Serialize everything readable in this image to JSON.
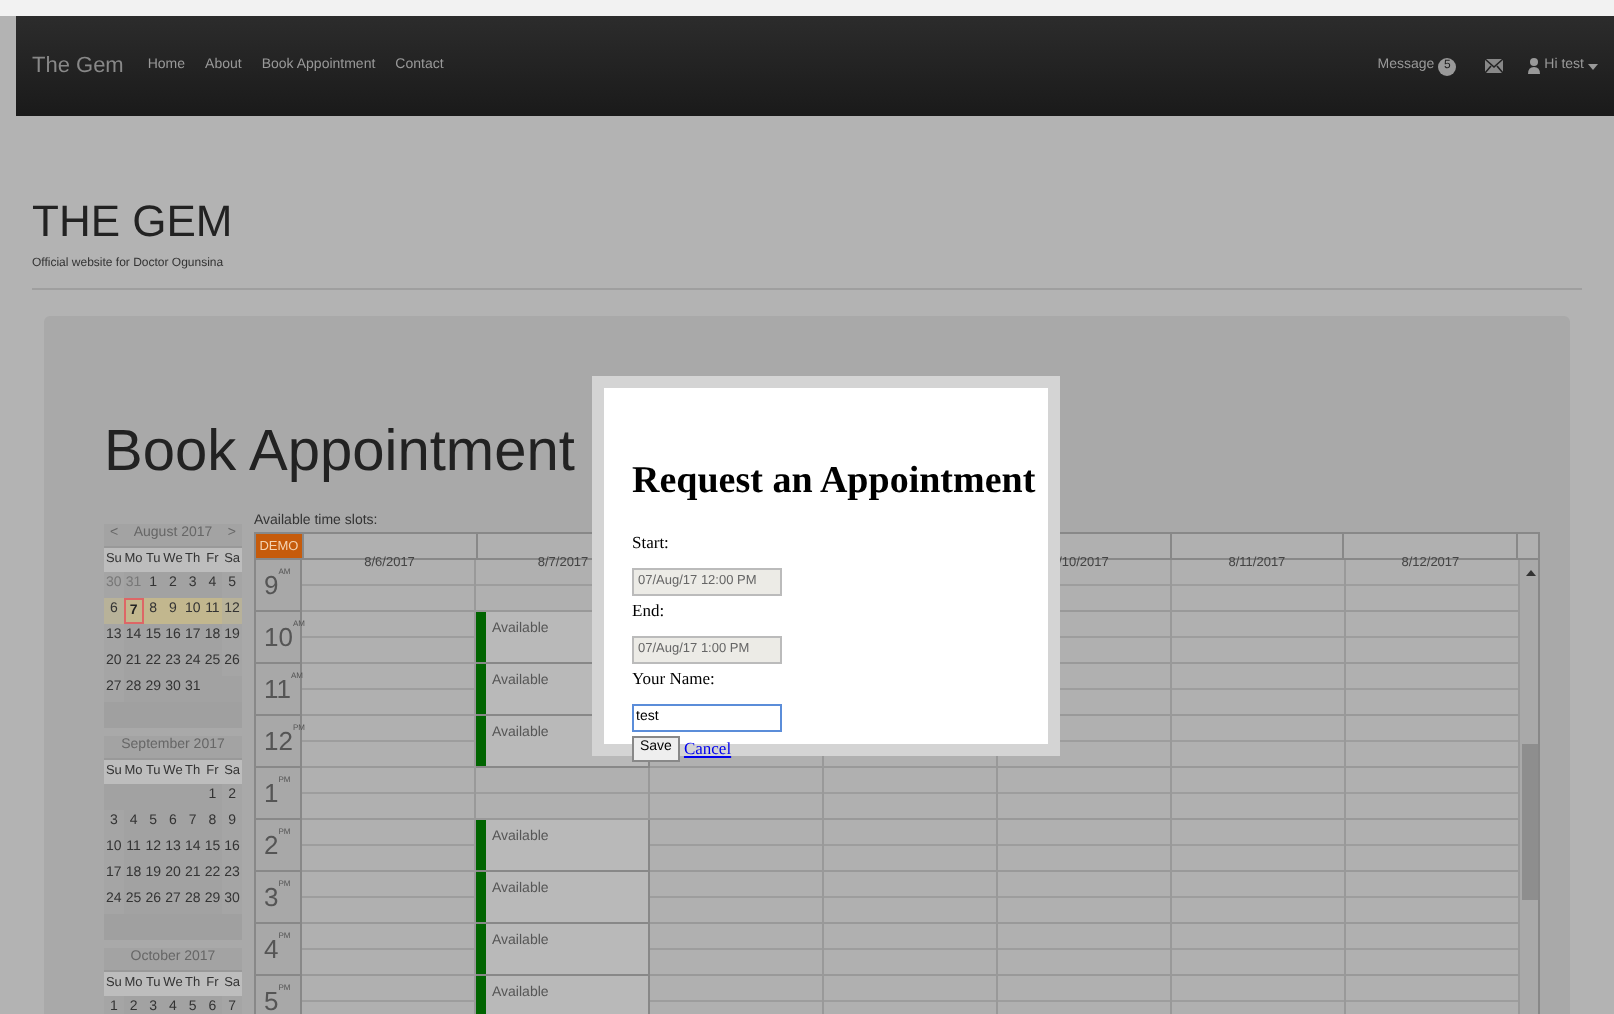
{
  "navbar": {
    "brand": "The Gem",
    "links": [
      "Home",
      "About",
      "Book Appointment",
      "Contact"
    ],
    "message": {
      "label": "Message",
      "count": "5"
    },
    "user": "Hi test"
  },
  "header": {
    "title": "THE GEM",
    "subtitle": "Official website for Doctor Ogunsina"
  },
  "page_title": "Book Appointment",
  "months": [
    {
      "title": "August 2017",
      "prev": "<",
      "next": ">",
      "weekdays": [
        "Su",
        "Mo",
        "Tu",
        "We",
        "Th",
        "Fr",
        "Sa"
      ],
      "weeks": [
        {
          "selected": false,
          "days": [
            {
              "t": "30",
              "kind": "other"
            },
            {
              "t": "31",
              "kind": "other"
            },
            {
              "t": "1",
              "kind": "day"
            },
            {
              "t": "2",
              "kind": "day"
            },
            {
              "t": "3",
              "kind": "day"
            },
            {
              "t": "4",
              "kind": "day"
            },
            {
              "t": "5",
              "kind": "day"
            }
          ]
        },
        {
          "selected": true,
          "days": [
            {
              "t": "6",
              "kind": "day"
            },
            {
              "t": "7",
              "kind": "today"
            },
            {
              "t": "8",
              "kind": "day"
            },
            {
              "t": "9",
              "kind": "day"
            },
            {
              "t": "10",
              "kind": "day"
            },
            {
              "t": "11",
              "kind": "day"
            },
            {
              "t": "12",
              "kind": "day"
            }
          ]
        },
        {
          "selected": false,
          "days": [
            {
              "t": "13",
              "kind": "day"
            },
            {
              "t": "14",
              "kind": "day"
            },
            {
              "t": "15",
              "kind": "day"
            },
            {
              "t": "16",
              "kind": "day"
            },
            {
              "t": "17",
              "kind": "day"
            },
            {
              "t": "18",
              "kind": "day"
            },
            {
              "t": "19",
              "kind": "day"
            }
          ]
        },
        {
          "selected": false,
          "days": [
            {
              "t": "20",
              "kind": "day"
            },
            {
              "t": "21",
              "kind": "day"
            },
            {
              "t": "22",
              "kind": "day"
            },
            {
              "t": "23",
              "kind": "day"
            },
            {
              "t": "24",
              "kind": "day"
            },
            {
              "t": "25",
              "kind": "day"
            },
            {
              "t": "26",
              "kind": "day"
            }
          ]
        },
        {
          "selected": false,
          "days": [
            {
              "t": "27",
              "kind": "day"
            },
            {
              "t": "28",
              "kind": "day"
            },
            {
              "t": "29",
              "kind": "day"
            },
            {
              "t": "30",
              "kind": "day"
            },
            {
              "t": "31",
              "kind": "day"
            },
            {
              "kind": "blank"
            },
            {
              "kind": "blank"
            }
          ]
        }
      ]
    },
    {
      "title": "September 2017",
      "weekdays": [
        "Su",
        "Mo",
        "Tu",
        "We",
        "Th",
        "Fr",
        "Sa"
      ],
      "weeks": [
        {
          "selected": false,
          "days": [
            {
              "kind": "blank"
            },
            {
              "kind": "blank"
            },
            {
              "kind": "blank"
            },
            {
              "kind": "blank"
            },
            {
              "kind": "blank"
            },
            {
              "t": "1",
              "kind": "day"
            },
            {
              "t": "2",
              "kind": "day"
            }
          ]
        },
        {
          "selected": false,
          "days": [
            {
              "t": "3",
              "kind": "day"
            },
            {
              "t": "4",
              "kind": "day"
            },
            {
              "t": "5",
              "kind": "day"
            },
            {
              "t": "6",
              "kind": "day"
            },
            {
              "t": "7",
              "kind": "day"
            },
            {
              "t": "8",
              "kind": "day"
            },
            {
              "t": "9",
              "kind": "day"
            }
          ]
        },
        {
          "selected": false,
          "days": [
            {
              "t": "10",
              "kind": "day"
            },
            {
              "t": "11",
              "kind": "day"
            },
            {
              "t": "12",
              "kind": "day"
            },
            {
              "t": "13",
              "kind": "day"
            },
            {
              "t": "14",
              "kind": "day"
            },
            {
              "t": "15",
              "kind": "day"
            },
            {
              "t": "16",
              "kind": "day"
            }
          ]
        },
        {
          "selected": false,
          "days": [
            {
              "t": "17",
              "kind": "day"
            },
            {
              "t": "18",
              "kind": "day"
            },
            {
              "t": "19",
              "kind": "day"
            },
            {
              "t": "20",
              "kind": "day"
            },
            {
              "t": "21",
              "kind": "day"
            },
            {
              "t": "22",
              "kind": "day"
            },
            {
              "t": "23",
              "kind": "day"
            }
          ]
        },
        {
          "selected": false,
          "days": [
            {
              "t": "24",
              "kind": "day"
            },
            {
              "t": "25",
              "kind": "day"
            },
            {
              "t": "26",
              "kind": "day"
            },
            {
              "t": "27",
              "kind": "day"
            },
            {
              "t": "28",
              "kind": "day"
            },
            {
              "t": "29",
              "kind": "day"
            },
            {
              "t": "30",
              "kind": "day"
            }
          ]
        }
      ]
    },
    {
      "title": "October 2017",
      "weekdays": [
        "Su",
        "Mo",
        "Tu",
        "We",
        "Th",
        "Fr",
        "Sa"
      ],
      "weeks": [
        {
          "selected": false,
          "days": [
            {
              "t": "1",
              "kind": "day"
            },
            {
              "t": "2",
              "kind": "day"
            },
            {
              "t": "3",
              "kind": "day"
            },
            {
              "t": "4",
              "kind": "day"
            },
            {
              "t": "5",
              "kind": "day"
            },
            {
              "t": "6",
              "kind": "day"
            },
            {
              "t": "7",
              "kind": "day"
            }
          ]
        }
      ]
    }
  ],
  "schedule": {
    "caption": "Available time slots:",
    "badge": "DEMO",
    "columns": [
      {
        "label": "8/6/2017"
      },
      {
        "label": "8/7/2017"
      },
      {},
      {},
      {
        "label": "/10/2017"
      },
      {
        "label": "8/11/2017"
      },
      {
        "label": "8/12/2017"
      }
    ],
    "hours": [
      {
        "hour": "9",
        "period": "AM",
        "slots": [
          {
            "kind": "free"
          },
          {
            "kind": "free"
          },
          {
            "kind": "free"
          },
          {
            "kind": "free"
          },
          {
            "kind": "free"
          },
          {
            "kind": "free"
          },
          {
            "kind": "free"
          }
        ]
      },
      {
        "hour": "10",
        "period": "AM",
        "slots": [
          {
            "kind": "free"
          },
          {
            "kind": "event",
            "label": "Available"
          },
          {
            "kind": "free"
          },
          {
            "kind": "free"
          },
          {
            "kind": "free"
          },
          {
            "kind": "free"
          },
          {
            "kind": "free"
          }
        ]
      },
      {
        "hour": "11",
        "period": "AM",
        "slots": [
          {
            "kind": "free"
          },
          {
            "kind": "event",
            "label": "Available"
          },
          {
            "kind": "free"
          },
          {
            "kind": "free"
          },
          {
            "kind": "free"
          },
          {
            "kind": "free"
          },
          {
            "kind": "free"
          }
        ]
      },
      {
        "hour": "12",
        "period": "PM",
        "slots": [
          {
            "kind": "free"
          },
          {
            "kind": "event",
            "label": "Available"
          },
          {
            "kind": "free"
          },
          {
            "kind": "free"
          },
          {
            "kind": "free"
          },
          {
            "kind": "free"
          },
          {
            "kind": "free"
          }
        ]
      },
      {
        "hour": "1",
        "period": "PM",
        "slots": [
          {
            "kind": "free"
          },
          {
            "kind": "free"
          },
          {
            "kind": "free"
          },
          {
            "kind": "free"
          },
          {
            "kind": "free"
          },
          {
            "kind": "free"
          },
          {
            "kind": "free"
          }
        ]
      },
      {
        "hour": "2",
        "period": "PM",
        "slots": [
          {
            "kind": "free"
          },
          {
            "kind": "event",
            "label": "Available"
          },
          {
            "kind": "free"
          },
          {
            "kind": "free"
          },
          {
            "kind": "free"
          },
          {
            "kind": "free"
          },
          {
            "kind": "free"
          }
        ]
      },
      {
        "hour": "3",
        "period": "PM",
        "slots": [
          {
            "kind": "free"
          },
          {
            "kind": "event",
            "label": "Available"
          },
          {
            "kind": "free"
          },
          {
            "kind": "free"
          },
          {
            "kind": "free"
          },
          {
            "kind": "free"
          },
          {
            "kind": "free"
          }
        ]
      },
      {
        "hour": "4",
        "period": "PM",
        "slots": [
          {
            "kind": "free"
          },
          {
            "kind": "event",
            "label": "Available"
          },
          {
            "kind": "free"
          },
          {
            "kind": "free"
          },
          {
            "kind": "free"
          },
          {
            "kind": "free"
          },
          {
            "kind": "free"
          }
        ]
      },
      {
        "hour": "5",
        "period": "PM",
        "slots": [
          {
            "kind": "free"
          },
          {
            "kind": "event",
            "label": "Available"
          },
          {
            "kind": "free"
          },
          {
            "kind": "free"
          },
          {
            "kind": "free"
          },
          {
            "kind": "free"
          },
          {
            "kind": "free"
          }
        ]
      }
    ]
  },
  "dialog": {
    "title": "Request an Appointment",
    "fields": [
      {
        "label": "Start:",
        "value": "07/Aug/17 12:00 PM",
        "disabled": true
      },
      {
        "label": "End:",
        "value": "07/Aug/17 1:00 PM",
        "disabled": true
      },
      {
        "label": "Your Name:",
        "value": "test",
        "disabled": false
      }
    ],
    "save": "Save",
    "cancel": "Cancel"
  }
}
